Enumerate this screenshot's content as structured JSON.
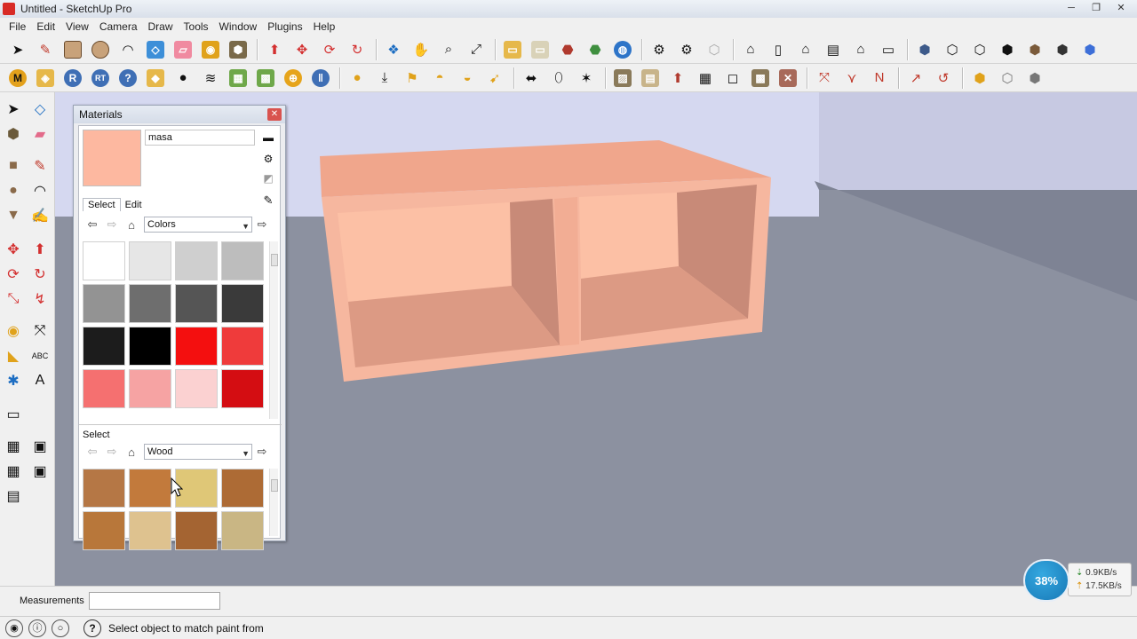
{
  "window": {
    "title": "Untitled - SketchUp Pro",
    "minimize": "─",
    "restore": "❐",
    "close": "✕"
  },
  "menu": [
    "File",
    "Edit",
    "View",
    "Camera",
    "Draw",
    "Tools",
    "Window",
    "Plugins",
    "Help"
  ],
  "materials": {
    "title": "Materials",
    "name_value": "masa",
    "current_color": "#fdb8a0",
    "tabs": [
      "Select",
      "Edit"
    ],
    "top_library": "Colors",
    "top_swatches": [
      "#ffffff",
      "#e6e6e6",
      "#cfcfcf",
      "#bdbdbd",
      "#939393",
      "#6e6e6e",
      "#555555",
      "#3a3a3a",
      "#1c1c1c",
      "#000000",
      "#f40f0f",
      "#ef3b3b",
      "#f57070",
      "#f6a3a3",
      "#fbd1d1",
      "#d40d12"
    ],
    "select_label": "Select",
    "bottom_library": "Wood",
    "bottom_swatches": [
      "#b57745",
      "#c27a3c",
      "#dfc777",
      "#ad6b35",
      "#b8773a",
      "#dec28f",
      "#a46432",
      "#c9b684"
    ]
  },
  "measurements": {
    "label": "Measurements",
    "value": ""
  },
  "status": {
    "help": "?",
    "text": "Select object to match paint from"
  },
  "network": {
    "percent": "38%",
    "down": "0.9KB/s",
    "up": "17.5KB/s"
  }
}
